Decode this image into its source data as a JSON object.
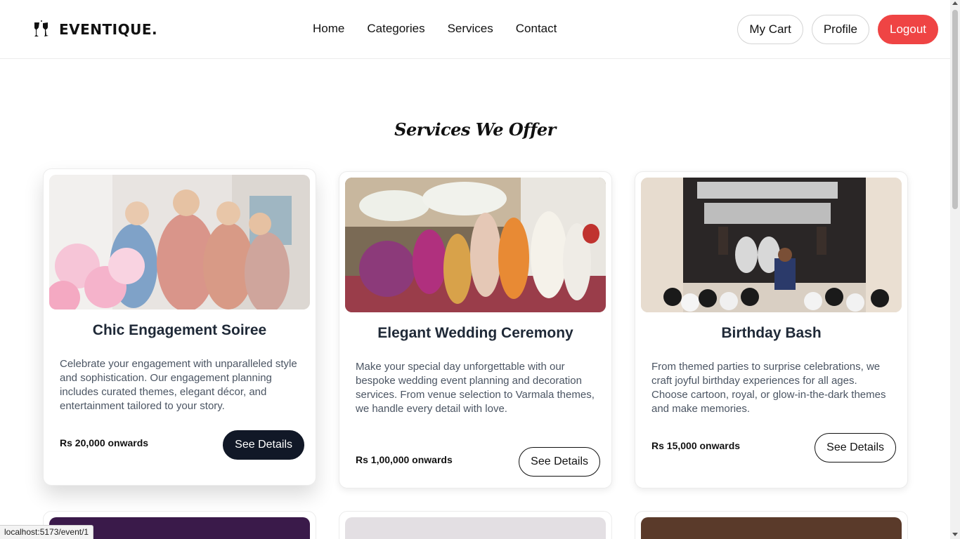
{
  "brand": {
    "name": "EVENTIQUE.",
    "icon": "champagne-glasses-icon"
  },
  "nav": [
    {
      "label": "Home"
    },
    {
      "label": "Categories"
    },
    {
      "label": "Services"
    },
    {
      "label": "Contact"
    }
  ],
  "actions": {
    "cart": "My Cart",
    "profile": "Profile",
    "logout": "Logout"
  },
  "section": {
    "title": "Services We Offer"
  },
  "cards": [
    {
      "title": "Chic Engagement Soiree",
      "description": "Celebrate your engagement with unparalleled style and sophistication. Our engagement planning includes curated themes, elegant décor, and entertainment tailored to your story.",
      "price": "Rs 20,000 onwards",
      "button": "See Details"
    },
    {
      "title": "Elegant Wedding Ceremony",
      "description": "Make your special day unforgettable with our bespoke wedding event planning and decoration services. From venue selection to Varmala themes, we handle every detail with love.",
      "price": "Rs 1,00,000 onwards",
      "button": "See Details"
    },
    {
      "title": "Birthday Bash",
      "description": "From themed parties to surprise celebrations, we craft joyful birthday experiences for all ages. Choose cartoon, royal, or glow-in-the-dark themes and make memories.",
      "price": "Rs 15,000 onwards",
      "button": "See Details"
    }
  ],
  "status_url": "localhost:5173/event/1",
  "colors": {
    "logout": "#ef4444",
    "dark_button": "#111827",
    "nav_progress": "#3b82f6"
  }
}
